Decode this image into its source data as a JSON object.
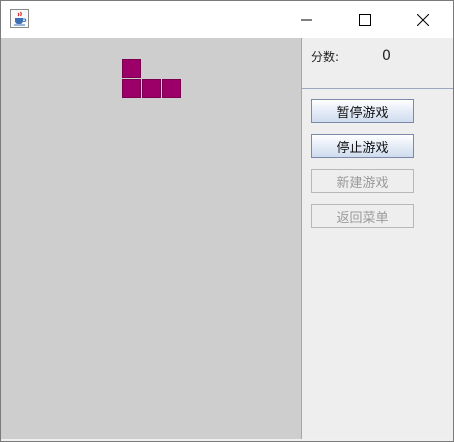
{
  "titlebar": {
    "icons": {
      "app": "java-cup-icon",
      "minimize": "minimize-icon",
      "maximize": "maximize-icon",
      "close": "close-icon"
    }
  },
  "game": {
    "piece_color": "#9c0068",
    "board_color": "#cecece",
    "piece_cells": [
      [
        6,
        1
      ],
      [
        6,
        2
      ],
      [
        7,
        2
      ],
      [
        8,
        2
      ]
    ]
  },
  "sidebar": {
    "score_label": "分数:",
    "score_value": "0",
    "buttons": {
      "pause": "暂停游戏",
      "stop": "停止游戏",
      "new_game": "新建游戏",
      "back_to_menu": "返回菜单"
    }
  }
}
